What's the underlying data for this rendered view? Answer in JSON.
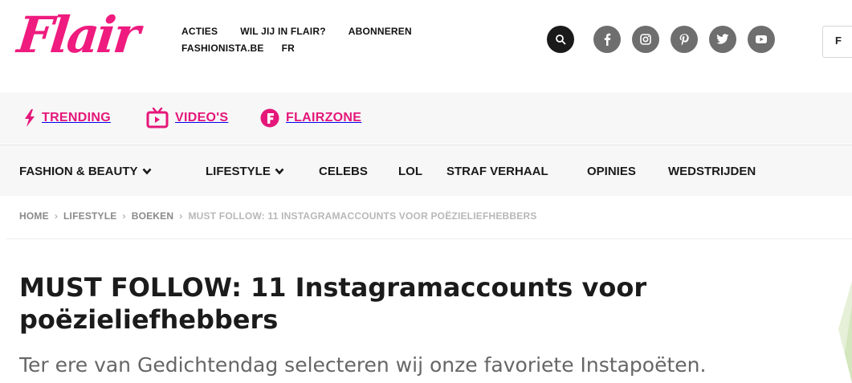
{
  "brand": {
    "logo_text": "Flair",
    "accent_color": "#ef1b7f"
  },
  "topnav": {
    "row1": [
      "ACTIES",
      "WIL JIJ IN FLAIR?",
      "ABONNEREN"
    ],
    "row2": [
      "FASHIONISTA.BE",
      "FR"
    ]
  },
  "header_icons": [
    "search-icon",
    "facebook-icon",
    "instagram-icon",
    "pinterest-icon",
    "twitter-icon",
    "youtube-icon"
  ],
  "lang_box_text": "F",
  "subbar": {
    "items": [
      {
        "label": "TRENDING",
        "icon": "lightning-icon"
      },
      {
        "label": "VIDEO'S",
        "icon": "tv-icon"
      },
      {
        "label": "FLAIRZONE",
        "icon": "flair-f-icon"
      }
    ]
  },
  "mainnav": {
    "items": [
      {
        "label": "FASHION & BEAUTY",
        "dropdown": true
      },
      {
        "label": "LIFESTYLE",
        "dropdown": true
      },
      {
        "label": "CELEBS",
        "dropdown": false
      },
      {
        "label": "LOL",
        "dropdown": false
      },
      {
        "label": "STRAF VERHAAL",
        "dropdown": false
      },
      {
        "label": "OPINIES",
        "dropdown": false
      },
      {
        "label": "WEDSTRIJDEN",
        "dropdown": false
      }
    ]
  },
  "breadcrumb": {
    "items": [
      "HOME",
      "LIFESTYLE",
      "BOEKEN"
    ],
    "current": "MUST FOLLOW: 11 INSTAGRAMACCOUNTS VOOR POËZIELIEFHEBBERS"
  },
  "article": {
    "title_line1": "MUST FOLLOW: 11 Instagramaccounts voor",
    "title_line2": "poëzieliefhebbers",
    "subtitle": "Ter ere van Gedichtendag selecteren wij onze favoriete Instapoëten."
  }
}
